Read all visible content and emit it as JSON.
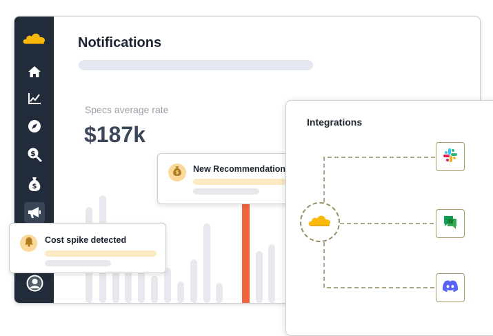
{
  "app": {
    "logo": "cloud-logo-icon"
  },
  "sidebar": {
    "items": [
      {
        "id": "home",
        "icon": "home-icon",
        "active": false
      },
      {
        "id": "analytics",
        "icon": "line-chart-icon",
        "active": false
      },
      {
        "id": "explore",
        "icon": "compass-icon",
        "active": false
      },
      {
        "id": "cost-search",
        "icon": "dollar-search-icon",
        "active": false
      },
      {
        "id": "savings",
        "icon": "money-bag-icon",
        "active": false
      },
      {
        "id": "notifications",
        "icon": "megaphone-icon",
        "active": true
      }
    ],
    "profile_icon": "user-avatar-icon"
  },
  "main": {
    "title": "Notifications",
    "metric": {
      "label": "Specs average rate",
      "value": "$187k"
    }
  },
  "cards": {
    "recommendations": {
      "title": "New Recommendations",
      "icon": "money-bag-icon"
    },
    "cost_spike": {
      "title": "Cost spike detected",
      "icon": "bell-icon"
    }
  },
  "integrations": {
    "title": "Integrations",
    "hub_icon": "cloud-logo-icon",
    "items": [
      {
        "name": "slack",
        "icon": "slack-icon"
      },
      {
        "name": "google-chat",
        "icon": "google-chat-icon"
      },
      {
        "name": "discord",
        "icon": "discord-icon"
      }
    ]
  },
  "colors": {
    "sidebar_bg": "#222b3a",
    "logo_yellow": "#f9b90b",
    "highlight_bar": "#f0643c",
    "bar_gray": "#e7e9ee",
    "card_icon_bg": "#fbd99a",
    "connector": "#968c65",
    "discord": "#5865f2",
    "google_chat": "#34a853"
  }
}
